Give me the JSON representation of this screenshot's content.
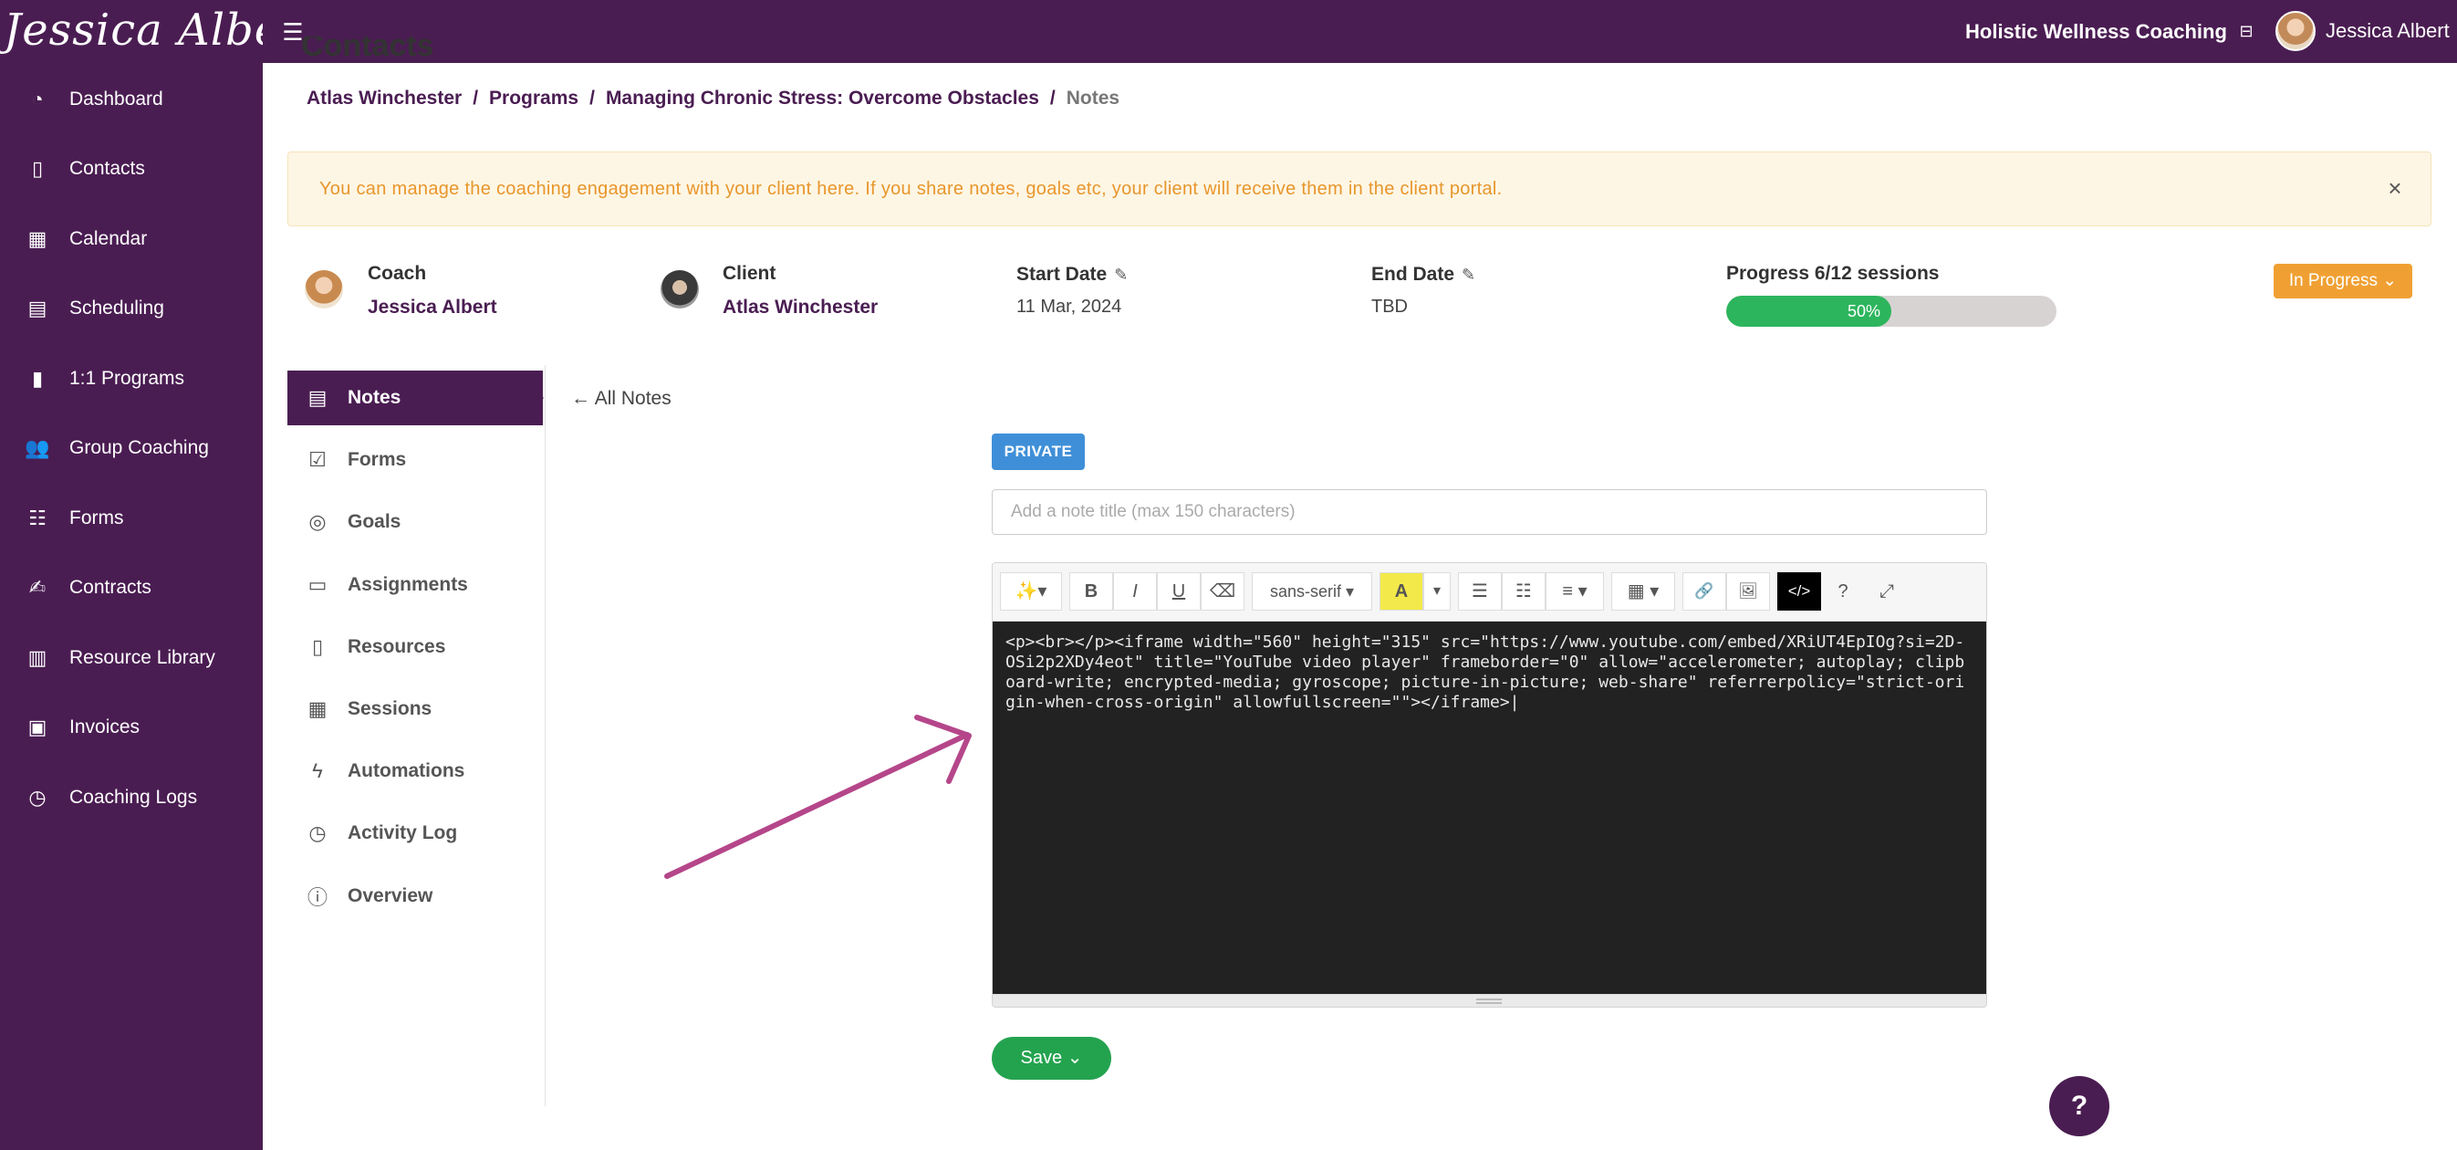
{
  "brand": {
    "signature": "Jessica Albert"
  },
  "topbar": {
    "organization": "Holistic Wellness Coaching",
    "user_name": "Jessica Albert"
  },
  "sidebar": {
    "items": [
      {
        "label": "Dashboard",
        "icon": "dashboard-gauge-icon"
      },
      {
        "label": "Contacts",
        "icon": "contacts-book-icon"
      },
      {
        "label": "Calendar",
        "icon": "calendar-icon"
      },
      {
        "label": "Scheduling",
        "icon": "scheduling-icon"
      },
      {
        "label": "1:1 Programs",
        "icon": "book-icon"
      },
      {
        "label": "Group Coaching",
        "icon": "users-icon"
      },
      {
        "label": "Forms",
        "icon": "list-icon"
      },
      {
        "label": "Contracts",
        "icon": "signature-icon"
      },
      {
        "label": "Resource Library",
        "icon": "library-icon"
      },
      {
        "label": "Invoices",
        "icon": "invoice-icon"
      },
      {
        "label": "Coaching Logs",
        "icon": "clock-icon"
      }
    ]
  },
  "page": {
    "title": "Contacts"
  },
  "breadcrumb": {
    "items": [
      "Atlas Winchester",
      "Programs",
      "Managing Chronic Stress: Overcome Obstacles"
    ],
    "current": "Notes",
    "separator": "/"
  },
  "alert": {
    "text": "You can manage the coaching engagement with your client here. If you share notes, goals etc, your client will receive them in the client portal.",
    "close": "×"
  },
  "engagement": {
    "coach_label": "Coach",
    "coach_name": "Jessica Albert",
    "client_label": "Client",
    "client_name": "Atlas Winchester",
    "start_label": "Start Date",
    "start_value": "11 Mar, 2024",
    "end_label": "End Date",
    "end_value": "TBD",
    "progress_label": "Progress 6/12 sessions",
    "progress_percent_text": "50%",
    "progress_fraction": 0.5,
    "status": "In Progress"
  },
  "subnav": {
    "items": [
      {
        "label": "Notes",
        "icon": "notes-icon",
        "active": true
      },
      {
        "label": "Forms",
        "icon": "checklist-icon"
      },
      {
        "label": "Goals",
        "icon": "target-icon"
      },
      {
        "label": "Assignments",
        "icon": "clipboard-icon"
      },
      {
        "label": "Resources",
        "icon": "book-icon"
      },
      {
        "label": "Sessions",
        "icon": "calendar-icon"
      },
      {
        "label": "Automations",
        "icon": "bolt-icon"
      },
      {
        "label": "Activity Log",
        "icon": "history-clock-icon"
      },
      {
        "label": "Overview",
        "icon": "info-icon"
      }
    ]
  },
  "editor": {
    "back_link": "All Notes",
    "privacy_badge": "PRIVATE",
    "title_placeholder": "Add a note title (max 150 characters)",
    "font_name": "sans-serif",
    "code_content": "<p><br></p><iframe width=\"560\" height=\"315\" src=\"https://www.youtube.com/embed/XRiUT4EpIOg?si=2D-OSi2p2XDy4eot\" title=\"YouTube video player\" frameborder=\"0\" allow=\"accelerometer; autoplay; clipboard-write; encrypted-media; gyroscope; picture-in-picture; web-share\" referrerpolicy=\"strict-origin-when-cross-origin\" allowfullscreen=\"\"></iframe>|",
    "save_label": "Save",
    "toolbar": {
      "magic": "✨▾",
      "bold": "B",
      "italic": "I",
      "underline": "U",
      "eraser": "⌫",
      "font": "sans-serif ▾",
      "color": "A",
      "color_dropdown": "▾",
      "bullet_list": "☰",
      "number_list": "☷",
      "align": "≡ ▾",
      "table": "▦ ▾",
      "link": "🔗",
      "picture": "🖼",
      "codeview": "</>",
      "help": "?",
      "fullscreen": "⤢"
    }
  },
  "help_button": "?",
  "colors": {
    "brand": "#4a1d52",
    "success": "#24a34f",
    "warning": "#f0a033",
    "info": "#3f8fd8",
    "annotation_arrow": "#b5468a"
  }
}
